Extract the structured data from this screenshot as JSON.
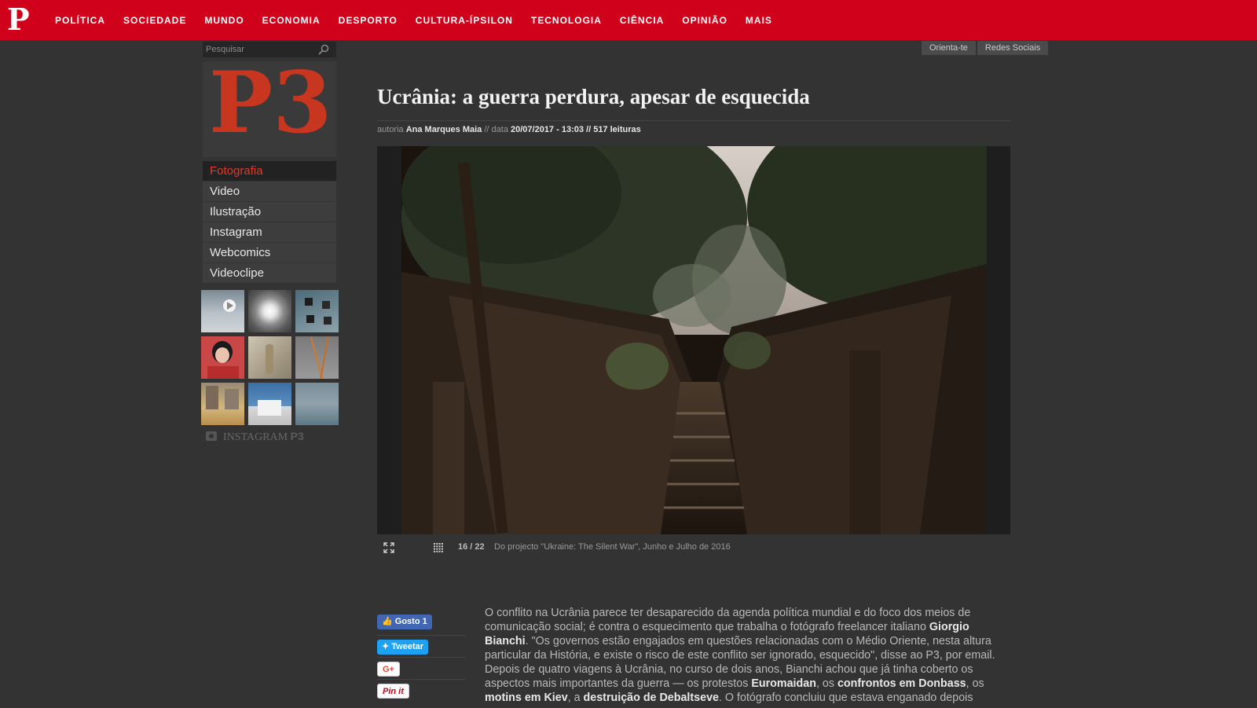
{
  "nav": {
    "logo": "P",
    "items": [
      "POLÍTICA",
      "SOCIEDADE",
      "MUNDO",
      "ECONOMIA",
      "DESPORTO",
      "CULTURA-ÍPSILON",
      "TECNOLOGIA",
      "CIÊNCIA",
      "OPINIÃO",
      "MAIS"
    ]
  },
  "search": {
    "placeholder": "Pesquisar"
  },
  "brand": {
    "logo_text": "P3"
  },
  "sidebar": {
    "items": [
      {
        "label": "Fotografia",
        "active": true
      },
      {
        "label": "Video",
        "active": false
      },
      {
        "label": "Ilustração",
        "active": false
      },
      {
        "label": "Instagram",
        "active": false
      },
      {
        "label": "Webcomics",
        "active": false
      },
      {
        "label": "Videoclipe",
        "active": false
      }
    ],
    "instagram_label": "INSTAGRAM",
    "instagram_brand": "P3"
  },
  "top_buttons": [
    "Orienta-te",
    "Redes Sociais"
  ],
  "article": {
    "title": "Ucrânia: a guerra perdura, apesar de esquecida",
    "author_prefix": "autoria",
    "author": "Ana Marques Maia",
    "date_prefix": "// data",
    "date": "20/07/2017 - 13:03",
    "reads": "// 517 leituras",
    "gallery_counter": "16 / 22",
    "gallery_caption": "Do projecto \"Ukraine: The Silent War\", Junho e Julho de 2016",
    "body": [
      "O conflito na Ucrânia parece ter desaparecido da agenda política mundial e do foco dos meios de comunicação social; é contra o esquecimento que trabalha o fotógrafo freelancer italiano ",
      "Giorgio Bianchi",
      ". \"Os governos estão engajados em questões relacionadas com o Médio Oriente, nesta altura particular da História, e existe o risco de este conflito ser ignorado, esquecido\", disse ao P3, por email. Depois de quatro viagens à Ucrânia, no curso de dois anos, Bianchi achou que já tinha coberto os aspectos mais importantes da guerra — os protestos ",
      "Euromaidan",
      ", os ",
      "confrontos em Donbass",
      ", os ",
      "motins em Kiev",
      ", a ",
      "destruição de Debaltseve",
      ". O fotógrafo concluiu que estava enganado depois"
    ]
  },
  "social": {
    "like": "Gosto 1",
    "tweet": "Tweetar",
    "gplus": "G+",
    "pin": "Pin it"
  }
}
